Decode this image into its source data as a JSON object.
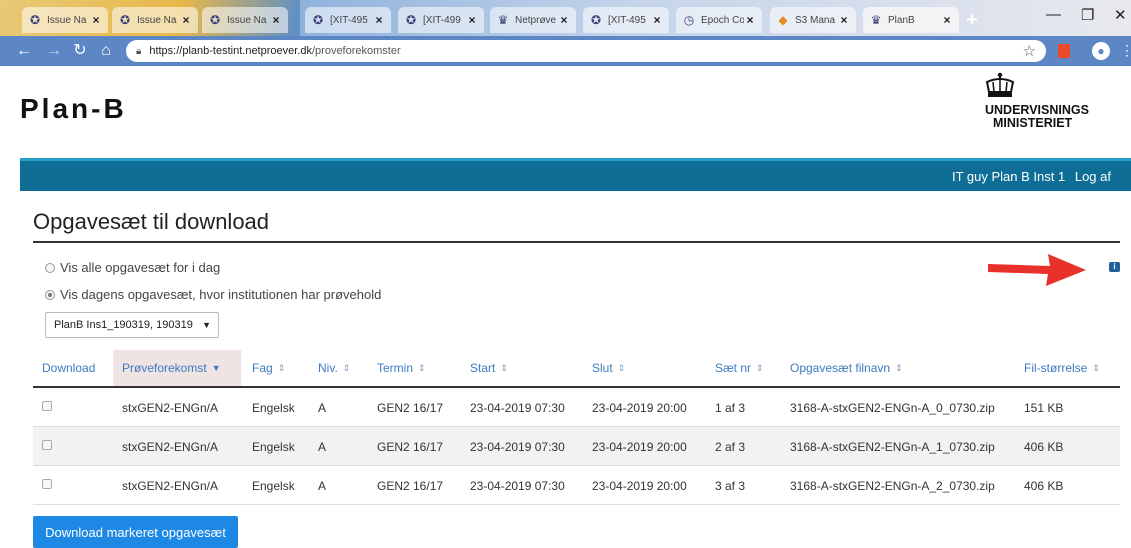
{
  "browser": {
    "tabs": [
      {
        "title": "Issue Na",
        "icon": "issue-icon"
      },
      {
        "title": "Issue Na",
        "icon": "issue-icon"
      },
      {
        "title": "Issue Na",
        "icon": "issue-icon"
      },
      {
        "title": "[XIT-495",
        "icon": "issue-icon"
      },
      {
        "title": "[XIT-499",
        "icon": "issue-icon"
      },
      {
        "title": "Netprøve",
        "icon": "crown-icon"
      },
      {
        "title": "[XIT-495",
        "icon": "issue-icon"
      },
      {
        "title": "Epoch Co",
        "icon": "clock-icon"
      },
      {
        "title": "S3 Mana",
        "icon": "box-icon"
      },
      {
        "title": "PlanB",
        "icon": "crown-icon"
      }
    ],
    "url_host": "https://planb-testint.netproever.dk",
    "url_path": "/proveforekomster"
  },
  "header": {
    "logo": "Plan-B",
    "ministry_line1": "UNDERVISNINGS",
    "ministry_line2": "MINISTERIET"
  },
  "navbar": {
    "user": "IT guy Plan B Inst 1",
    "logout": "Log af"
  },
  "page": {
    "title": "Opgavesæt til download",
    "radio_all": "Vis alle opgavesæt for i dag",
    "radio_today": "Vis dagens opgavesæt, hvor institutionen har prøvehold",
    "select_value": "PlanB Ins1_190319, 190319",
    "download_button": "Download markeret opgavesæt"
  },
  "table": {
    "headers": {
      "download": "Download",
      "proveforekomst": "Prøveforekomst",
      "fag": "Fag",
      "niv": "Niv.",
      "termin": "Termin",
      "start": "Start",
      "slut": "Slut",
      "saet_nr": "Sæt nr",
      "filnavn": "Opgavesæt filnavn",
      "filstorrelse": "Fil-størrelse"
    },
    "rows": [
      {
        "proveforekomst": "stxGEN2-ENGn/A",
        "fag": "Engelsk",
        "niv": "A",
        "termin": "GEN2 16/17",
        "start": "23-04-2019 07:30",
        "slut": "23-04-2019 20:00",
        "saet_nr": "1 af 3",
        "filnavn": "3168-A-stxGEN2-ENGn-A_0_0730.zip",
        "filstorrelse": "151 KB"
      },
      {
        "proveforekomst": "stxGEN2-ENGn/A",
        "fag": "Engelsk",
        "niv": "A",
        "termin": "GEN2 16/17",
        "start": "23-04-2019 07:30",
        "slut": "23-04-2019 20:00",
        "saet_nr": "2 af 3",
        "filnavn": "3168-A-stxGEN2-ENGn-A_1_0730.zip",
        "filstorrelse": "406 KB"
      },
      {
        "proveforekomst": "stxGEN2-ENGn/A",
        "fag": "Engelsk",
        "niv": "A",
        "termin": "GEN2 16/17",
        "start": "23-04-2019 07:30",
        "slut": "23-04-2019 20:00",
        "saet_nr": "3 af 3",
        "filnavn": "3168-A-stxGEN2-ENGn-A_2_0730.zip",
        "filstorrelse": "406 KB"
      }
    ]
  },
  "colors": {
    "navbar": "#0f6e96",
    "link": "#3b7bc0",
    "button": "#1e88e5",
    "arrow": "#e8312a"
  }
}
